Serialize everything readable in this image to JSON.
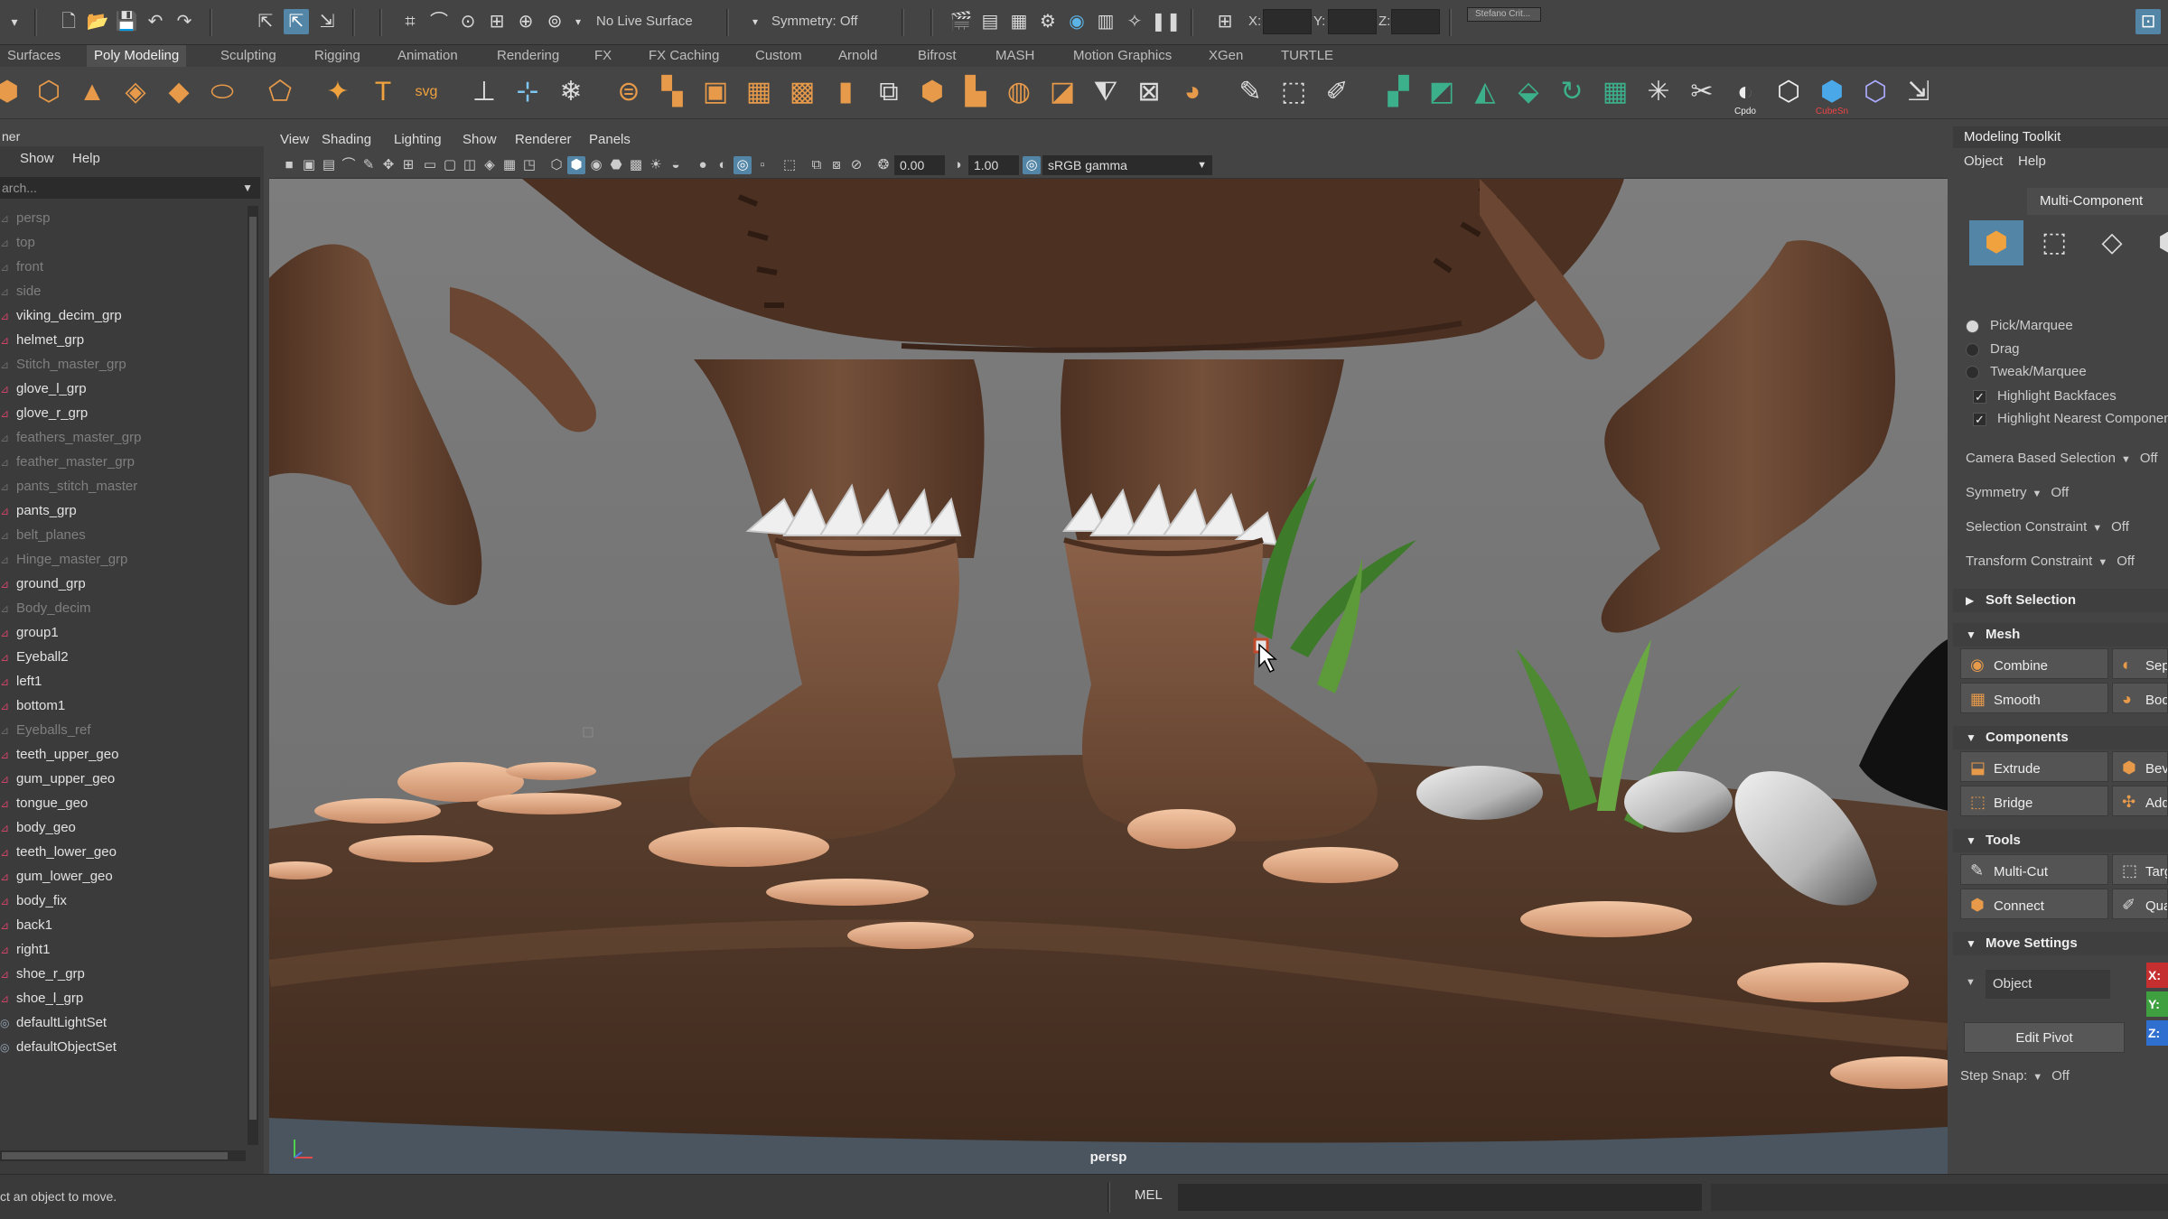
{
  "status_line": {
    "live_surface": "No Live Surface",
    "symmetry": "Symmetry: Off",
    "x_label": "X:",
    "y_label": "Y:",
    "z_label": "Z:",
    "account": "Stefano Crit..."
  },
  "shelf": {
    "tabs": [
      "Surfaces",
      "Poly Modeling",
      "Sculpting",
      "Rigging",
      "Animation",
      "Rendering",
      "FX",
      "FX Caching",
      "Custom",
      "Arnold",
      "Bifrost",
      "MASH",
      "Motion Graphics",
      "XGen",
      "TURTLE"
    ],
    "active_tab": "Poly Modeling",
    "captions": {
      "cpdo": "Cpdo",
      "cubesn": "CubeSn"
    }
  },
  "outliner": {
    "title": "ner",
    "menu": [
      "Show",
      "Help"
    ],
    "search_placeholder": "arch...",
    "items": [
      {
        "label": "persp",
        "dim": true
      },
      {
        "label": "top",
        "dim": true
      },
      {
        "label": "front",
        "dim": true
      },
      {
        "label": "side",
        "dim": true
      },
      {
        "label": "viking_decim_grp",
        "dim": false
      },
      {
        "label": "helmet_grp",
        "dim": false
      },
      {
        "label": "Stitch_master_grp",
        "dim": true
      },
      {
        "label": "glove_l_grp",
        "dim": false
      },
      {
        "label": "glove_r_grp",
        "dim": false
      },
      {
        "label": "feathers_master_grp",
        "dim": true
      },
      {
        "label": "feather_master_grp",
        "dim": true
      },
      {
        "label": "pants_stitch_master",
        "dim": true
      },
      {
        "label": "pants_grp",
        "dim": false
      },
      {
        "label": "belt_planes",
        "dim": true
      },
      {
        "label": "Hinge_master_grp",
        "dim": true
      },
      {
        "label": "ground_grp",
        "dim": false
      },
      {
        "label": "Body_decim",
        "dim": true
      },
      {
        "label": "group1",
        "dim": false
      },
      {
        "label": "Eyeball2",
        "dim": false
      },
      {
        "label": "left1",
        "dim": false
      },
      {
        "label": "bottom1",
        "dim": false
      },
      {
        "label": "Eyeballs_ref",
        "dim": true
      },
      {
        "label": "teeth_upper_geo",
        "dim": false
      },
      {
        "label": "gum_upper_geo",
        "dim": false
      },
      {
        "label": "tongue_geo",
        "dim": false
      },
      {
        "label": "body_geo",
        "dim": false
      },
      {
        "label": "teeth_lower_geo",
        "dim": false
      },
      {
        "label": "gum_lower_geo",
        "dim": false
      },
      {
        "label": "body_fix",
        "dim": false
      },
      {
        "label": "back1",
        "dim": false
      },
      {
        "label": "right1",
        "dim": false
      },
      {
        "label": "shoe_r_grp",
        "dim": false
      },
      {
        "label": "shoe_l_grp",
        "dim": false
      },
      {
        "label": "defaultLightSet",
        "dim": false,
        "set": true
      },
      {
        "label": "defaultObjectSet",
        "dim": false,
        "set": true
      }
    ]
  },
  "viewport": {
    "menu": [
      "View",
      "Shading",
      "Lighting",
      "Show",
      "Renderer",
      "Panels"
    ],
    "exposure": "0.00",
    "gamma": "1.00",
    "color_space": "sRGB gamma",
    "camera": "persp"
  },
  "toolkit": {
    "title": "Modeling Toolkit",
    "menu": [
      "Object",
      "Help"
    ],
    "multi_component": "Multi-Component",
    "radios": [
      "Pick/Marquee",
      "Drag",
      "Tweak/Marquee"
    ],
    "checks": [
      "Highlight Backfaces",
      "Highlight Nearest Component"
    ],
    "rows": [
      {
        "label": "Camera Based Selection",
        "value": "Off"
      },
      {
        "label": "Symmetry",
        "value": "Off"
      },
      {
        "label": "Selection Constraint",
        "value": "Off"
      },
      {
        "label": "Transform Constraint",
        "value": "Off"
      }
    ],
    "sections": {
      "soft": "Soft Selection",
      "mesh": "Mesh",
      "components": "Components",
      "tools": "Tools",
      "move": "Move Settings"
    },
    "mesh_buttons": [
      "Combine",
      "Separate",
      "Smooth",
      "Boolean"
    ],
    "component_buttons": [
      "Extrude",
      "Bevel",
      "Bridge",
      "Add Divisions"
    ],
    "tool_buttons": [
      "Multi-Cut",
      "Target Weld",
      "Connect",
      "Quad Draw"
    ],
    "move_space": "Object",
    "xyz": [
      "X:",
      "Y:",
      "Z:"
    ],
    "edit_pivot": "Edit Pivot",
    "step_snap_label": "Step Snap:",
    "step_snap_value": "Off"
  },
  "help_line": {
    "message": "ct an object to move.",
    "mel": "MEL"
  },
  "colors": {
    "accent_blue": "#5285a6",
    "shelf_orange": "#e79a4a",
    "skin": "#6b4632",
    "boot": "#7a5440"
  }
}
